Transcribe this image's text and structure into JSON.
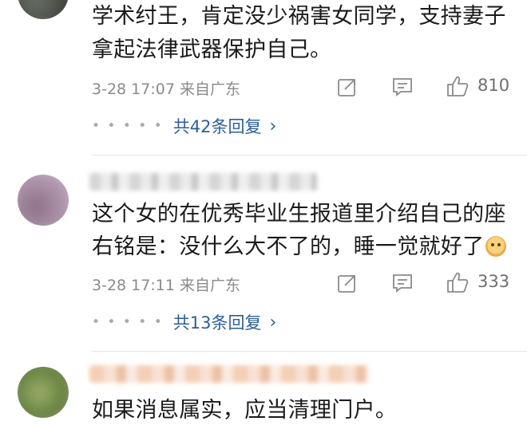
{
  "comments": [
    {
      "lines": [
        "学术纣王，肯定没少祸害女同学，支持妻子",
        "拿起法律武器保护自己。"
      ],
      "date": "3-28",
      "time": "17:07",
      "source": "来自广东",
      "likes": "810",
      "replies_label": "共42条回复",
      "avatar_colors": [
        "#3b3f3a",
        "#6d7268",
        "#9aa096"
      ]
    },
    {
      "lines": [
        "这个女的在优秀毕业生报道里介绍自己的座",
        "右铭是：没什么大不了的，睡一觉就好了"
      ],
      "emoji_icon": "doge-face-icon",
      "date": "3-28",
      "time": "17:11",
      "source": "来自广东",
      "likes": "333",
      "replies_label": "共13条回复",
      "avatar_colors": [
        "#8a6f86",
        "#b49ab1",
        "#d9c7d5"
      ]
    },
    {
      "lines": [
        "如果消息属实，应当清理门户。"
      ],
      "avatar_colors": [
        "#5f7a3c",
        "#9fb36b",
        "#e8efe0"
      ]
    }
  ],
  "icons": {
    "share": "share-edit-icon",
    "comment": "comment-icon",
    "like": "thumbs-up-icon",
    "more": "chevron-right-icon"
  },
  "colors": {
    "link_blue": "#2c5e97",
    "meta_gray": "#8a8a8a"
  }
}
